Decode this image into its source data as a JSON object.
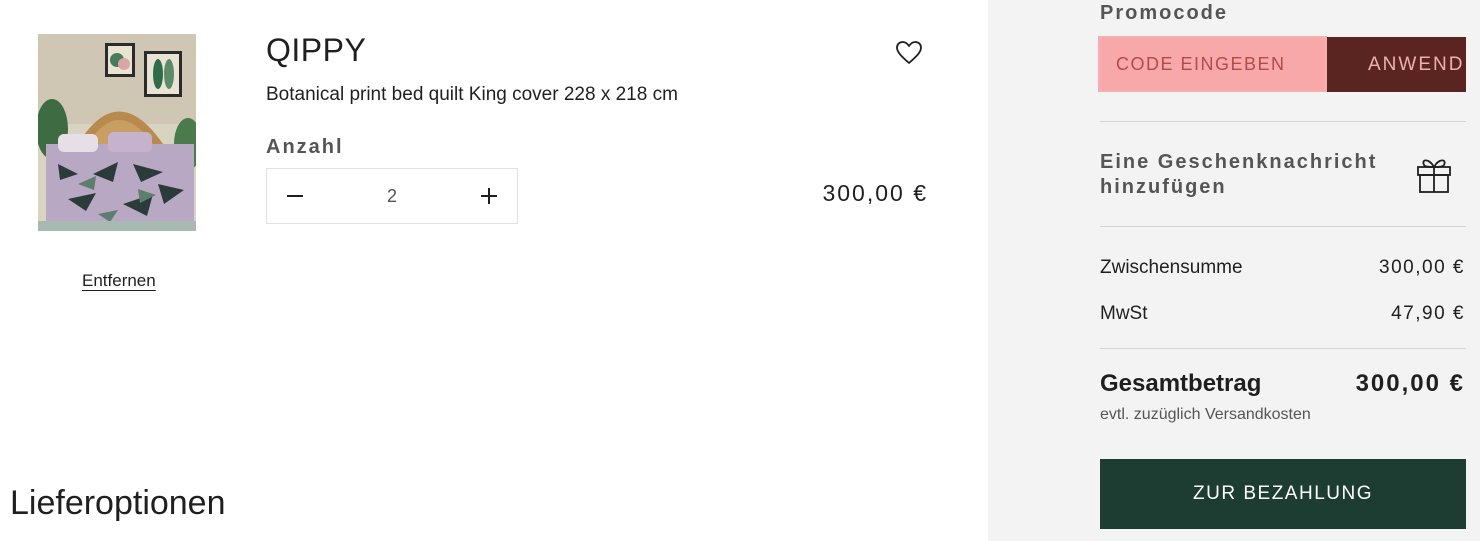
{
  "item": {
    "brand": "QIPPY",
    "name": "Botanical print bed quilt King cover 228 x 218 cm",
    "quantity_label": "Anzahl",
    "quantity": "2",
    "price": "300,00 €",
    "remove_label": "Entfernen",
    "image_icon": "bedroom-product-photo",
    "wishlist_icon": "heart-icon"
  },
  "delivery": {
    "heading": "Lieferoptionen"
  },
  "summary": {
    "promo_label": "Promocode",
    "promo_placeholder": "CODE EINGEBEN",
    "apply_label": "ANWENDEN",
    "gift_message": "Eine Geschenknachricht hinzufügen",
    "gift_icon": "gift-icon",
    "subtotal_label": "Zwischensumme",
    "subtotal_value": "300,00 €",
    "vat_label": "MwSt",
    "vat_value": "47,90 €",
    "total_label": "Gesamtbetrag",
    "total_value": "300,00 €",
    "shipping_note": "evtl. zuzüglich Versandkosten",
    "checkout_label": "ZUR BEZAHLUNG"
  },
  "colors": {
    "checkout_bg": "#1d3d33",
    "apply_bg": "#5a2420",
    "promo_highlight": "#f8a8a8",
    "summary_bg": "#f3f3f3"
  }
}
